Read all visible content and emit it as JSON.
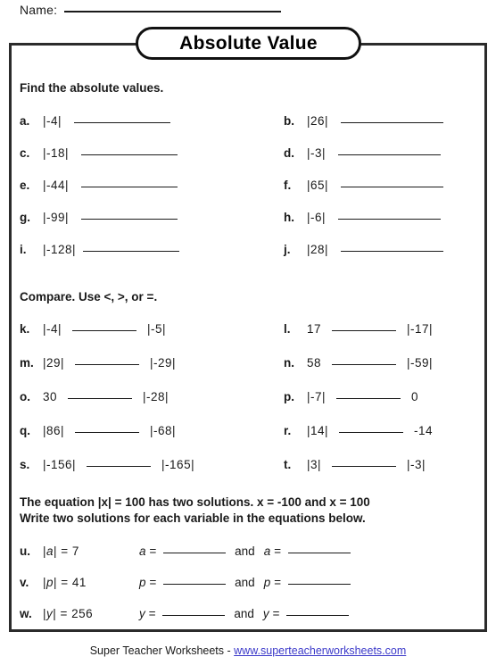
{
  "header": {
    "name_label": "Name:"
  },
  "title": "Absolute Value",
  "section1": {
    "heading": "Find the absolute values.",
    "left": [
      {
        "letter": "a.",
        "expr": "|-4|"
      },
      {
        "letter": "c.",
        "expr": "|-18|"
      },
      {
        "letter": "e.",
        "expr": "|-44|"
      },
      {
        "letter": "g.",
        "expr": "|-99|"
      },
      {
        "letter": "i.",
        "expr": "|-128|"
      }
    ],
    "right": [
      {
        "letter": "b.",
        "expr": "|26|"
      },
      {
        "letter": "d.",
        "expr": "|-3|"
      },
      {
        "letter": "f.",
        "expr": "|65|"
      },
      {
        "letter": "h.",
        "expr": "|-6|"
      },
      {
        "letter": "j.",
        "expr": "|28|"
      }
    ]
  },
  "section2": {
    "heading": "Compare.  Use <, >, or =.",
    "left": [
      {
        "letter": "k.",
        "expr": "|-4|",
        "rhs": "|-5|"
      },
      {
        "letter": "m.",
        "expr": "|29|",
        "rhs": "|-29|"
      },
      {
        "letter": "o.",
        "expr": "30",
        "rhs": "|-28|"
      },
      {
        "letter": "q.",
        "expr": "|86|",
        "rhs": "|-68|"
      },
      {
        "letter": "s.",
        "expr": "|-156|",
        "rhs": "|-165|"
      }
    ],
    "right": [
      {
        "letter": "l.",
        "expr": "17",
        "rhs": "|-17|"
      },
      {
        "letter": "n.",
        "expr": "58",
        "rhs": "|-59|"
      },
      {
        "letter": "p.",
        "expr": "|-7|",
        "rhs": "0"
      },
      {
        "letter": "r.",
        "expr": "|14|",
        "rhs": "-14"
      },
      {
        "letter": "t.",
        "expr": "|3|",
        "rhs": "|-3|"
      }
    ]
  },
  "section3": {
    "note_line1": "The equation |x| = 100 has two solutions.  x = -100  and  x = 100",
    "note_line2": "Write two solutions for each variable in the equations below.",
    "and_label": "and",
    "rows": [
      {
        "letter": "u.",
        "equation_var": "a",
        "equation": "| | = 7",
        "eq_prefix": "|",
        "eq_suffix": "| = 7",
        "solution_prefix": "a ="
      },
      {
        "letter": "v.",
        "equation_var": "p",
        "equation": "| | = 41",
        "eq_prefix": "|",
        "eq_suffix": "| = 41",
        "solution_prefix": "p ="
      },
      {
        "letter": "w.",
        "equation_var": "y",
        "equation": "| | = 256",
        "eq_prefix": "|",
        "eq_suffix": "| = 256",
        "solution_prefix": "y ="
      }
    ]
  },
  "footer": {
    "brand": "Super Teacher Worksheets  -  ",
    "site": "www.superteacherworksheets.com",
    "link_color": "#3b39c9"
  }
}
